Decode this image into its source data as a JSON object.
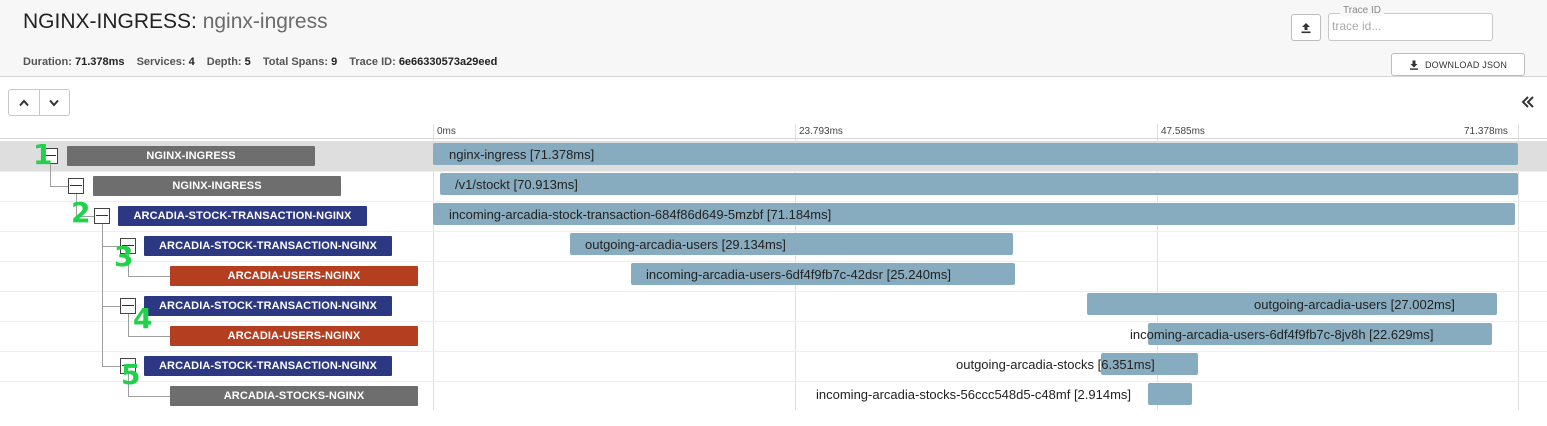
{
  "header": {
    "service": "NGINX-INGRESS",
    "operation": "nginx-ingress",
    "trace_id_label": "Trace ID",
    "trace_id_placeholder": "trace id...",
    "download_label": "DOWNLOAD JSON",
    "meta": {
      "duration_label": "Duration:",
      "duration": "71.378ms",
      "services_label": "Services:",
      "services": "4",
      "depth_label": "Depth:",
      "depth": "5",
      "spans_label": "Total Spans:",
      "spans": "9",
      "traceid_label": "Trace ID:",
      "traceid": "6e66330573a29eed"
    }
  },
  "ticks": [
    "0ms",
    "23.793ms",
    "47.585ms",
    "71.378ms"
  ],
  "rows": [
    {
      "service": "NGINX-INGRESS",
      "color": "#6e6e6e",
      "span": "nginx-ingress [71.378ms]"
    },
    {
      "service": "NGINX-INGRESS",
      "color": "#6e6e6e",
      "span": "/v1/stockt [70.913ms]"
    },
    {
      "service": "ARCADIA-STOCK-TRANSACTION-NGINX",
      "color": "#2c3881",
      "span": "incoming-arcadia-stock-transaction-684f86d649-5mzbf [71.184ms]"
    },
    {
      "service": "ARCADIA-STOCK-TRANSACTION-NGINX",
      "color": "#2c3881",
      "span": "outgoing-arcadia-users [29.134ms]"
    },
    {
      "service": "ARCADIA-USERS-NGINX",
      "color": "#b33e20",
      "span": "incoming-arcadia-users-6df4f9fb7c-42dsr [25.240ms]"
    },
    {
      "service": "ARCADIA-STOCK-TRANSACTION-NGINX",
      "color": "#2c3881",
      "span": "outgoing-arcadia-users [27.002ms]"
    },
    {
      "service": "ARCADIA-USERS-NGINX",
      "color": "#b33e20",
      "span": "incoming-arcadia-users-6df4f9fb7c-8jv8h [22.629ms]"
    },
    {
      "service": "ARCADIA-STOCK-TRANSACTION-NGINX",
      "color": "#2c3881",
      "span": "outgoing-arcadia-stocks [6.351ms]"
    },
    {
      "service": "ARCADIA-STOCKS-NGINX",
      "color": "#6e6e6e",
      "span": "incoming-arcadia-stocks-56ccc548d5-c48mf [2.914ms]"
    }
  ],
  "markers": [
    "1",
    "2",
    "3",
    "4",
    "5"
  ],
  "icons": {
    "upload": "upload-icon",
    "download": "download-icon",
    "up": "chevron-up-icon",
    "down": "chevron-down-icon",
    "collapse": "double-chevron-left-icon",
    "toggle": "minus-square-icon"
  },
  "colors": {
    "bar": "#88acbf",
    "marker": "#1fd24a"
  }
}
